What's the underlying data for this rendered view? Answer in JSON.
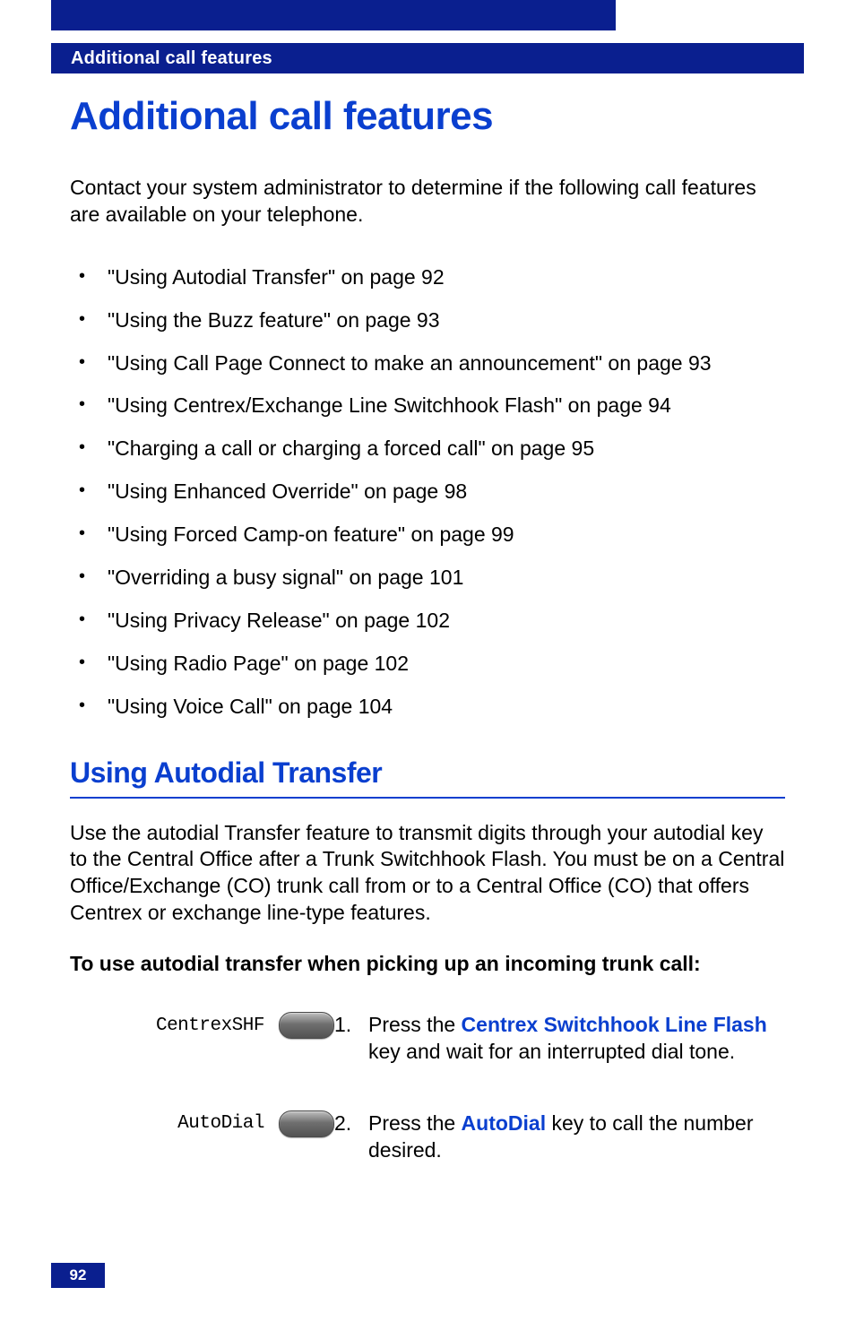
{
  "header": {
    "running": "Additional call features"
  },
  "title": "Additional call features",
  "intro": "Contact your system administrator to determine if the following call features are available on your telephone.",
  "bullets": [
    "\"Using Autodial Transfer\" on page 92",
    "\"Using the Buzz feature\" on page 93",
    "\"Using Call Page Connect to make an announcement\" on page 93",
    "\"Using Centrex/Exchange Line Switchhook Flash\" on page 94",
    "\"Charging a call or charging a forced call\" on page 95",
    "\"Using Enhanced Override\" on page 98",
    "\"Using Forced Camp-on feature\" on page 99",
    "\"Overriding a busy signal\" on page 101",
    "\"Using Privacy Release\" on page 102",
    "\"Using Radio Page\" on page 102",
    "\"Using Voice Call\" on page 104"
  ],
  "section": {
    "heading": "Using Autodial Transfer",
    "text": "Use the autodial Transfer feature to transmit digits through your autodial key to the Central Office after a Trunk Switchhook Flash. You must be on a Central Office/Exchange (CO) trunk call from or to a Central Office (CO) that offers Centrex or exchange line-type features.",
    "subhead": "To use autodial transfer when picking up an incoming trunk call:",
    "steps": [
      {
        "key_label": "CentrexSHF",
        "num": "1.",
        "pre": "Press the ",
        "feature": "Centrex Switchhook Line Flash",
        "post": " key and wait for an interrupted dial tone."
      },
      {
        "key_label": "AutoDial",
        "num": "2.",
        "pre": "Press the ",
        "feature": "AutoDial",
        "post": " key to call the number desired."
      }
    ]
  },
  "page_number": "92"
}
